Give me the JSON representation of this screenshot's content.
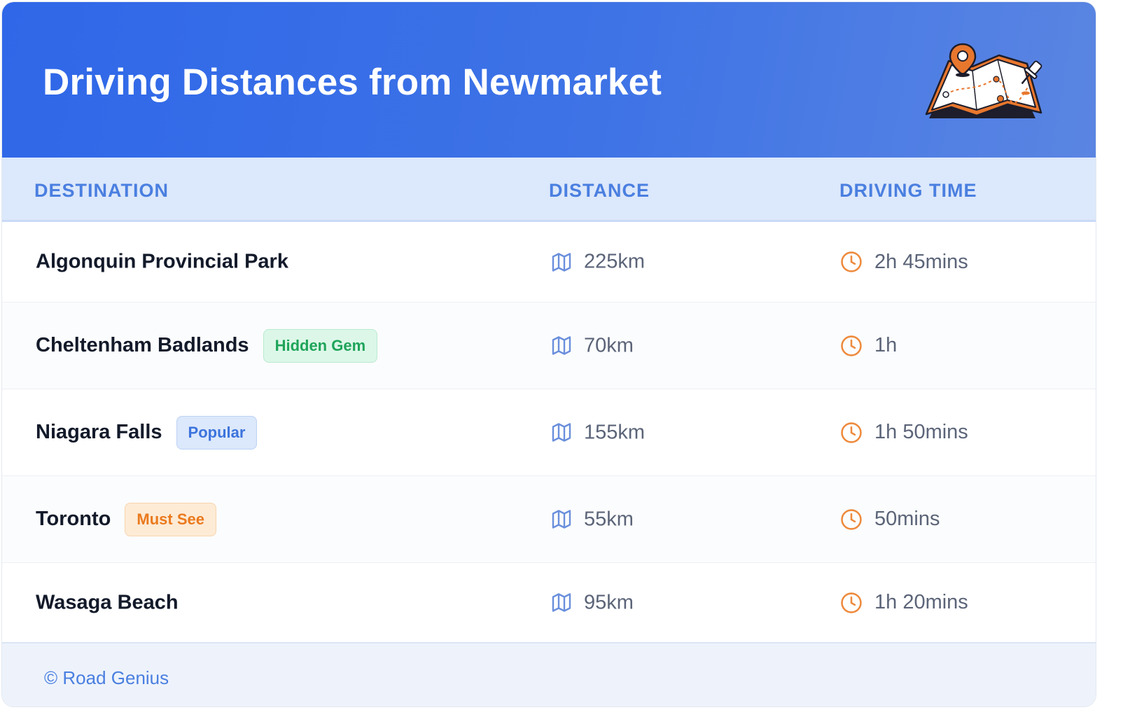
{
  "header": {
    "title": "Driving Distances from Newmarket",
    "illustration_icon": "map-with-pins"
  },
  "columns": {
    "destination": "DESTINATION",
    "distance": "DISTANCE",
    "driving_time": "DRIVING TIME"
  },
  "rows": [
    {
      "destination": "Algonquin Provincial Park",
      "badge": "",
      "distance": "225km",
      "time": "2h 45mins"
    },
    {
      "destination": "Cheltenham Badlands",
      "badge": "Hidden Gem",
      "distance": "70km",
      "time": "1h"
    },
    {
      "destination": "Niagara Falls",
      "badge": "Popular",
      "distance": "155km",
      "time": "1h 50mins"
    },
    {
      "destination": "Toronto",
      "badge": "Must See",
      "distance": "55km",
      "time": "50mins"
    },
    {
      "destination": "Wasaga Beach",
      "badge": "",
      "distance": "95km",
      "time": "1h 20mins"
    }
  ],
  "icons": {
    "distance": "map-icon",
    "time": "clock-icon"
  },
  "colors": {
    "header_gradient_start": "#2f67e8",
    "header_gradient_end": "#5a85e2",
    "column_header_text": "#4a7fe0",
    "clock_icon": "#ee8a3c",
    "map_icon": "#6a8fdc",
    "badge_green": "#1fa45a",
    "badge_blue": "#3d74dd",
    "badge_orange": "#ea7a1e"
  },
  "footer": {
    "credit": "© Road Genius"
  }
}
